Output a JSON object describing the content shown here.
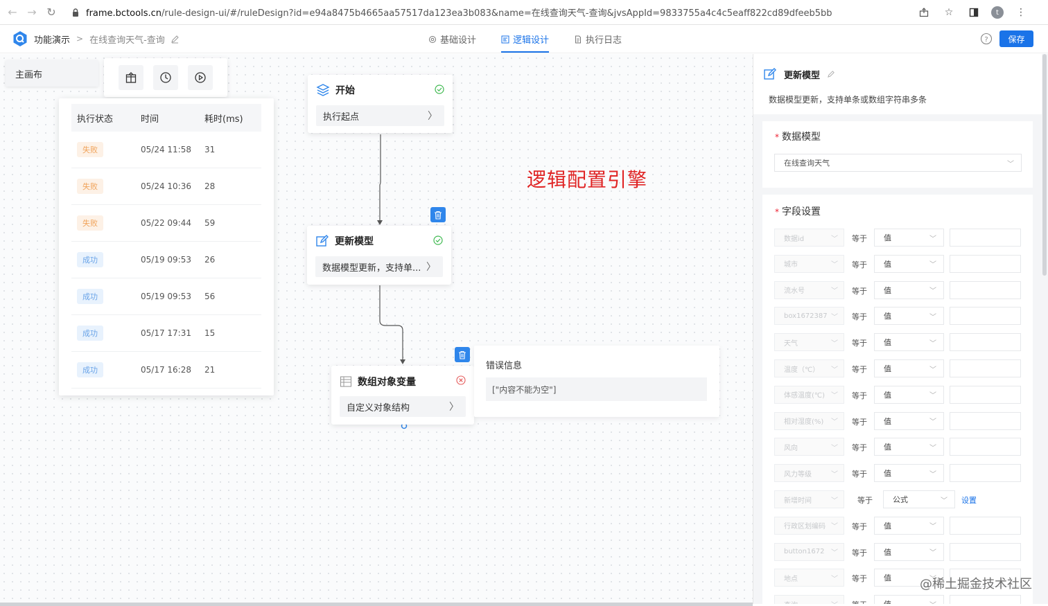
{
  "browser": {
    "url_host": "frame.bctools.cn",
    "url_rest": "/rule-design-ui/#/ruleDesign?id=e94a8475b4665aa57517da123ea3b083&name=在线查询天气-查询&jvsAppId=9833755a4c4c5eaff822cd89dfeeb5bb",
    "profile_initial": "t"
  },
  "header": {
    "crumb_root": "功能演示",
    "crumb_current": "在线查询天气-查询",
    "tabs": [
      {
        "label": "基础设计",
        "icon": "gear-icon"
      },
      {
        "label": "逻辑设计",
        "icon": "layout-icon"
      },
      {
        "label": "执行日志",
        "icon": "document-icon"
      }
    ],
    "save_label": "保存",
    "accent": "#1a73e8"
  },
  "canvas": {
    "main_tab": "主画布",
    "log": {
      "headers": [
        "执行状态",
        "时间",
        "耗时(ms)"
      ],
      "rows": [
        {
          "status": "失败",
          "kind": "fail",
          "time": "05/24 11:58",
          "cost": "31"
        },
        {
          "status": "失败",
          "kind": "fail",
          "time": "05/24 10:36",
          "cost": "28"
        },
        {
          "status": "失败",
          "kind": "fail",
          "time": "05/22 09:44",
          "cost": "59"
        },
        {
          "status": "成功",
          "kind": "ok",
          "time": "05/19 09:53",
          "cost": "26"
        },
        {
          "status": "成功",
          "kind": "ok",
          "time": "05/19 09:53",
          "cost": "56"
        },
        {
          "status": "成功",
          "kind": "ok",
          "time": "05/17 17:31",
          "cost": "15"
        },
        {
          "status": "成功",
          "kind": "ok",
          "time": "05/17 16:28",
          "cost": "21"
        }
      ]
    },
    "nodes": {
      "start": {
        "title": "开始",
        "body": "执行起点"
      },
      "update": {
        "title": "更新模型",
        "body": "数据模型更新，支持单..."
      },
      "array": {
        "title": "数组对象变量",
        "body": "自定义对象结构"
      }
    },
    "error": {
      "title": "错误信息",
      "content": "[\"内容不能为空\"]"
    },
    "annotation": "逻辑配置引擎"
  },
  "panel": {
    "title": "更新模型",
    "description": "数据模型更新，支持单条或数组字符串多条",
    "model_label": "数据模型",
    "model_value": "在线查询天气",
    "fields_label": "字段设置",
    "equals": "等于",
    "set_label": "设置",
    "fields": [
      {
        "name": "数据id",
        "type": "值"
      },
      {
        "name": "城市",
        "type": "值"
      },
      {
        "name": "流水号",
        "type": "值"
      },
      {
        "name": "box1672387",
        "type": "值"
      },
      {
        "name": "天气",
        "type": "值"
      },
      {
        "name": "温度（℃）",
        "type": "值"
      },
      {
        "name": "体感温度(℃)",
        "type": "值"
      },
      {
        "name": "相对湿度(%)",
        "type": "值"
      },
      {
        "name": "风向",
        "type": "值"
      },
      {
        "name": "风力等级",
        "type": "值"
      },
      {
        "name": "新增时间",
        "type": "公式",
        "formula": true
      },
      {
        "name": "行政区划编码",
        "type": "值"
      },
      {
        "name": "button1672",
        "type": "值"
      },
      {
        "name": "地点",
        "type": "值"
      },
      {
        "name": "查询",
        "type": "值"
      }
    ]
  },
  "watermark": "@稀土掘金技术社区"
}
